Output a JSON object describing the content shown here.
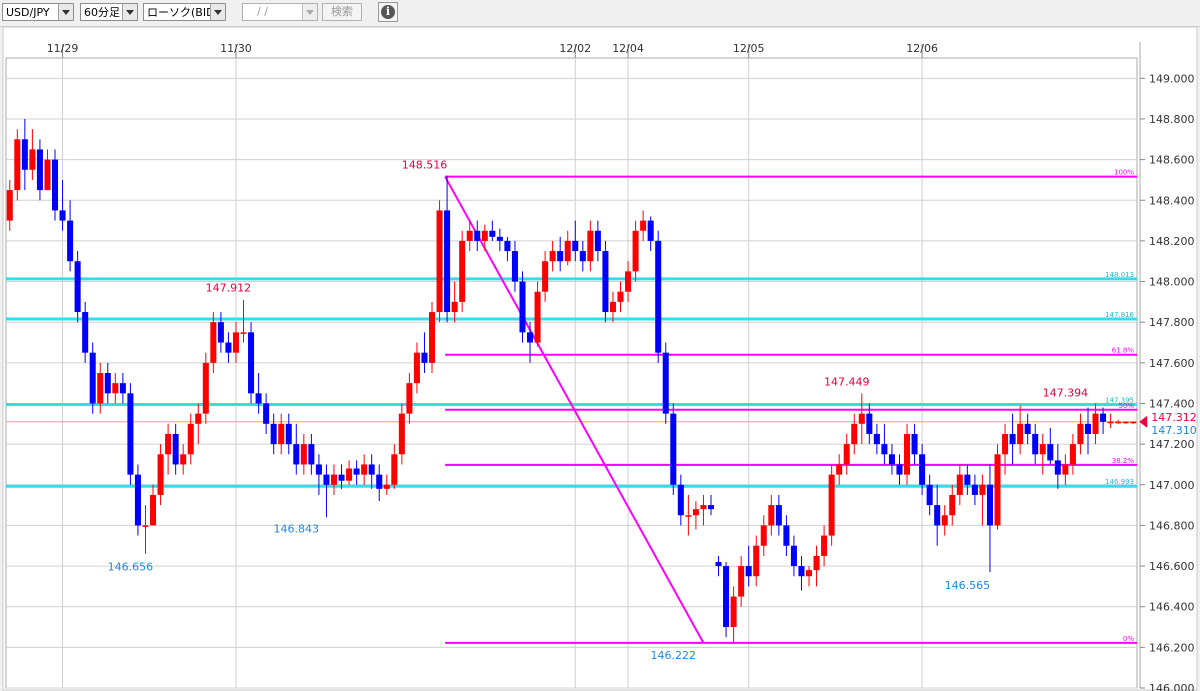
{
  "toolbar": {
    "pair": "USD/JPY",
    "timeframe": "60分足",
    "price_type": "ローソク(BID)",
    "date_value": "/ /",
    "search_label": "検索",
    "info_icon": "info-icon"
  },
  "colors": {
    "up": "#ff0000",
    "down": "#0000ff",
    "fib": "#ff00ff",
    "level": "#33ddee",
    "current": "#ffa64d",
    "grid": "#d0d0d0",
    "axis_text": "#333333",
    "label_high": "#e8003c",
    "label_low": "#1e88e5"
  },
  "chart_data": {
    "type": "candlestick",
    "title": "",
    "xlabel": "",
    "ylabel": "",
    "ylim": [
      146.0,
      149.1
    ],
    "y_ticks": [
      "146.000",
      "146.200",
      "146.400",
      "146.600",
      "146.800",
      "147.000",
      "147.200",
      "147.400",
      "147.600",
      "147.800",
      "148.000",
      "148.200",
      "148.400",
      "148.600",
      "148.800",
      "149.000"
    ],
    "x_ticks": [
      {
        "label": "11/29",
        "bar": 7
      },
      {
        "label": "11/30",
        "bar": 30
      },
      {
        "label": "12/02",
        "bar": 75
      },
      {
        "label": "12/04",
        "bar": 82
      },
      {
        "label": "12/05",
        "bar": 98
      },
      {
        "label": "12/06",
        "bar": 121
      }
    ],
    "grid": true,
    "bar_count": 150,
    "candles": [
      [
        148.3,
        148.5,
        148.25,
        148.45
      ],
      [
        148.45,
        148.75,
        148.4,
        148.7
      ],
      [
        148.7,
        148.8,
        148.45,
        148.55
      ],
      [
        148.55,
        148.75,
        148.5,
        148.65
      ],
      [
        148.65,
        148.7,
        148.4,
        148.45
      ],
      [
        148.45,
        148.65,
        148.45,
        148.6
      ],
      [
        148.6,
        148.65,
        148.3,
        148.35
      ],
      [
        148.35,
        148.5,
        148.25,
        148.3
      ],
      [
        148.3,
        148.4,
        148.05,
        148.1
      ],
      [
        148.1,
        148.15,
        147.8,
        147.85
      ],
      [
        147.85,
        147.9,
        147.6,
        147.65
      ],
      [
        147.65,
        147.7,
        147.35,
        147.4
      ],
      [
        147.4,
        147.6,
        147.35,
        147.55
      ],
      [
        147.55,
        147.6,
        147.4,
        147.45
      ],
      [
        147.45,
        147.55,
        147.4,
        147.5
      ],
      [
        147.5,
        147.55,
        147.4,
        147.45
      ],
      [
        147.45,
        147.5,
        147.0,
        147.05
      ],
      [
        147.05,
        147.1,
        146.75,
        146.8
      ],
      [
        146.8,
        146.9,
        146.66,
        146.8
      ],
      [
        146.8,
        147.0,
        146.8,
        146.95
      ],
      [
        146.95,
        147.2,
        146.9,
        147.15
      ],
      [
        147.15,
        147.3,
        147.05,
        147.25
      ],
      [
        147.25,
        147.3,
        147.05,
        147.1
      ],
      [
        147.1,
        147.2,
        147.05,
        147.15
      ],
      [
        147.15,
        147.35,
        147.1,
        147.3
      ],
      [
        147.3,
        147.4,
        147.2,
        147.35
      ],
      [
        147.35,
        147.65,
        147.3,
        147.6
      ],
      [
        147.6,
        147.85,
        147.55,
        147.8
      ],
      [
        147.8,
        147.85,
        147.65,
        147.7
      ],
      [
        147.7,
        147.75,
        147.6,
        147.65
      ],
      [
        147.65,
        147.8,
        147.6,
        147.75
      ],
      [
        147.75,
        147.91,
        147.7,
        147.75
      ],
      [
        147.75,
        147.8,
        147.4,
        147.45
      ],
      [
        147.45,
        147.55,
        147.35,
        147.4
      ],
      [
        147.4,
        147.45,
        147.25,
        147.3
      ],
      [
        147.3,
        147.35,
        147.15,
        147.2
      ],
      [
        147.2,
        147.35,
        147.15,
        147.3
      ],
      [
        147.3,
        147.35,
        147.15,
        147.2
      ],
      [
        147.2,
        147.3,
        147.05,
        147.1
      ],
      [
        147.1,
        147.25,
        147.05,
        147.2
      ],
      [
        147.2,
        147.25,
        147.05,
        147.1
      ],
      [
        147.1,
        147.15,
        146.95,
        147.05
      ],
      [
        147.05,
        147.1,
        146.84,
        147.0
      ],
      [
        147.0,
        147.1,
        146.95,
        147.05
      ],
      [
        147.05,
        147.1,
        146.98,
        147.02
      ],
      [
        147.02,
        147.12,
        147.0,
        147.08
      ],
      [
        147.08,
        147.12,
        147.0,
        147.05
      ],
      [
        147.05,
        147.15,
        147.0,
        147.1
      ],
      [
        147.1,
        147.15,
        146.98,
        147.05
      ],
      [
        147.05,
        147.1,
        146.92,
        146.98
      ],
      [
        146.98,
        147.05,
        146.95,
        147.0
      ],
      [
        147.0,
        147.2,
        146.98,
        147.15
      ],
      [
        147.15,
        147.4,
        147.1,
        147.35
      ],
      [
        147.35,
        147.55,
        147.3,
        147.5
      ],
      [
        147.5,
        147.7,
        147.45,
        147.65
      ],
      [
        147.65,
        147.75,
        147.55,
        147.6
      ],
      [
        147.6,
        147.9,
        147.55,
        147.85
      ],
      [
        147.85,
        148.4,
        147.8,
        148.35
      ],
      [
        148.35,
        148.52,
        147.8,
        147.85
      ],
      [
        147.85,
        148.0,
        147.8,
        147.9
      ],
      [
        147.9,
        148.25,
        147.85,
        148.2
      ],
      [
        148.2,
        148.3,
        148.15,
        148.25
      ],
      [
        148.25,
        148.3,
        148.15,
        148.2
      ],
      [
        148.2,
        148.28,
        148.15,
        148.25
      ],
      [
        148.25,
        148.3,
        148.2,
        148.22
      ],
      [
        148.22,
        148.26,
        148.15,
        148.2
      ],
      [
        148.2,
        148.22,
        148.1,
        148.15
      ],
      [
        148.15,
        148.2,
        147.95,
        148.0
      ],
      [
        148.0,
        148.05,
        147.7,
        147.75
      ],
      [
        147.75,
        147.8,
        147.6,
        147.7
      ],
      [
        147.7,
        148.0,
        147.68,
        147.95
      ],
      [
        147.95,
        148.15,
        147.9,
        148.1
      ],
      [
        148.1,
        148.2,
        148.05,
        148.15
      ],
      [
        148.15,
        148.22,
        148.05,
        148.1
      ],
      [
        148.1,
        148.25,
        148.08,
        148.2
      ],
      [
        148.2,
        148.3,
        148.1,
        148.15
      ],
      [
        148.15,
        148.2,
        148.05,
        148.1
      ],
      [
        148.1,
        148.3,
        148.05,
        148.25
      ],
      [
        148.25,
        148.3,
        148.1,
        148.15
      ],
      [
        148.15,
        148.2,
        147.8,
        147.85
      ],
      [
        147.85,
        147.95,
        147.8,
        147.9
      ],
      [
        147.9,
        148.0,
        147.85,
        147.95
      ],
      [
        147.95,
        148.1,
        147.9,
        148.05
      ],
      [
        148.05,
        148.3,
        148.0,
        148.25
      ],
      [
        148.25,
        148.35,
        148.2,
        148.3
      ],
      [
        148.3,
        148.32,
        148.15,
        148.2
      ],
      [
        148.2,
        148.25,
        147.6,
        147.65
      ],
      [
        147.65,
        147.7,
        147.3,
        147.35
      ],
      [
        147.35,
        147.4,
        146.95,
        147.0
      ],
      [
        147.0,
        147.05,
        146.8,
        146.85
      ],
      [
        146.85,
        146.95,
        146.75,
        146.85
      ],
      [
        146.85,
        146.92,
        146.78,
        146.88
      ],
      [
        146.88,
        146.95,
        146.8,
        146.9
      ],
      [
        146.9,
        146.95,
        146.85,
        146.88
      ],
      [
        146.62,
        146.65,
        146.55,
        146.6
      ],
      [
        146.6,
        146.62,
        146.25,
        146.3
      ],
      [
        146.3,
        146.5,
        146.22,
        146.45
      ],
      [
        146.45,
        146.65,
        146.4,
        146.6
      ],
      [
        146.6,
        146.7,
        146.5,
        146.55
      ],
      [
        146.55,
        146.75,
        146.5,
        146.7
      ],
      [
        146.7,
        146.85,
        146.65,
        146.8
      ],
      [
        146.8,
        146.95,
        146.75,
        146.9
      ],
      [
        146.9,
        146.95,
        146.75,
        146.8
      ],
      [
        146.8,
        146.85,
        146.65,
        146.7
      ],
      [
        146.7,
        146.75,
        146.55,
        146.6
      ],
      [
        146.6,
        146.65,
        146.48,
        146.55
      ],
      [
        146.55,
        146.6,
        146.5,
        146.58
      ],
      [
        146.58,
        146.7,
        146.5,
        146.65
      ],
      [
        146.65,
        146.8,
        146.6,
        146.75
      ],
      [
        146.75,
        147.1,
        146.7,
        147.05
      ],
      [
        147.05,
        147.15,
        147.0,
        147.1
      ],
      [
        147.1,
        147.25,
        147.05,
        147.2
      ],
      [
        147.2,
        147.35,
        147.15,
        147.3
      ],
      [
        147.3,
        147.45,
        147.2,
        147.35
      ],
      [
        147.35,
        147.4,
        147.2,
        147.25
      ],
      [
        147.25,
        147.3,
        147.15,
        147.2
      ],
      [
        147.2,
        147.3,
        147.1,
        147.15
      ],
      [
        147.15,
        147.2,
        147.05,
        147.1
      ],
      [
        147.1,
        147.15,
        147.0,
        147.05
      ],
      [
        147.05,
        147.3,
        147.0,
        147.25
      ],
      [
        147.25,
        147.3,
        147.1,
        147.15
      ],
      [
        147.15,
        147.2,
        146.95,
        147.0
      ],
      [
        147.0,
        147.05,
        146.85,
        146.9
      ],
      [
        146.9,
        147.0,
        146.7,
        146.8
      ],
      [
        146.8,
        146.9,
        146.75,
        146.85
      ],
      [
        146.85,
        147.0,
        146.8,
        146.95
      ],
      [
        146.95,
        147.1,
        146.9,
        147.05
      ],
      [
        147.05,
        147.1,
        146.95,
        147.0
      ],
      [
        147.0,
        147.05,
        146.9,
        146.95
      ],
      [
        146.95,
        147.05,
        146.8,
        147.0
      ],
      [
        147.0,
        147.1,
        146.57,
        146.8
      ],
      [
        146.8,
        147.2,
        146.78,
        147.15
      ],
      [
        147.15,
        147.3,
        147.05,
        147.25
      ],
      [
        147.25,
        147.35,
        147.1,
        147.2
      ],
      [
        147.2,
        147.39,
        147.15,
        147.3
      ],
      [
        147.3,
        147.35,
        147.2,
        147.25
      ],
      [
        147.25,
        147.3,
        147.1,
        147.15
      ],
      [
        147.15,
        147.25,
        147.05,
        147.2
      ],
      [
        147.2,
        147.28,
        147.1,
        147.12
      ],
      [
        147.12,
        147.2,
        146.98,
        147.05
      ],
      [
        147.05,
        147.15,
        147.0,
        147.1
      ],
      [
        147.1,
        147.25,
        147.05,
        147.2
      ],
      [
        147.2,
        147.35,
        147.15,
        147.3
      ],
      [
        147.3,
        147.38,
        147.15,
        147.25
      ],
      [
        147.25,
        147.4,
        147.2,
        147.35
      ],
      [
        147.35,
        147.38,
        147.25,
        147.31
      ],
      [
        147.31,
        147.35,
        147.28,
        147.31
      ],
      [
        147.31,
        147.32,
        147.3,
        147.31
      ],
      [
        147.31,
        147.31,
        147.3,
        147.31
      ],
      [
        147.31,
        147.31,
        147.3,
        147.31
      ]
    ],
    "fibonacci": {
      "high": 148.516,
      "low": 146.222,
      "high_bar": 58,
      "low_bar": 92,
      "levels": [
        {
          "label": "100%",
          "value": 148.516
        },
        {
          "label": "61.8%",
          "value": 147.64
        },
        {
          "label": "50%",
          "value": 147.369
        },
        {
          "label": "38.2%",
          "value": 147.098
        },
        {
          "label": "0%",
          "value": 146.222
        }
      ]
    },
    "horizontal_lines": [
      {
        "label": "148.013",
        "value": 148.013
      },
      {
        "label": "147.816",
        "value": 147.816
      },
      {
        "label": "147.395",
        "value": 147.395
      },
      {
        "label": "146.993",
        "value": 146.993
      }
    ],
    "current_price": 147.31,
    "price_tags": {
      "ask": "147.312",
      "bid": "147.310"
    },
    "annotations": [
      {
        "text": "148.516",
        "bar": 55,
        "value": 148.516,
        "kind": "high"
      },
      {
        "text": "147.912",
        "bar": 29,
        "value": 147.912,
        "kind": "high"
      },
      {
        "text": "147.449",
        "bar": 111,
        "value": 147.449,
        "kind": "high"
      },
      {
        "text": "147.394",
        "bar": 140,
        "value": 147.394,
        "kind": "high"
      },
      {
        "text": "146.656",
        "bar": 16,
        "value": 146.656,
        "kind": "low"
      },
      {
        "text": "146.843",
        "bar": 38,
        "value": 146.843,
        "kind": "low"
      },
      {
        "text": "146.222",
        "bar": 88,
        "value": 146.222,
        "kind": "low"
      },
      {
        "text": "146.565",
        "bar": 127,
        "value": 146.565,
        "kind": "low"
      }
    ]
  }
}
